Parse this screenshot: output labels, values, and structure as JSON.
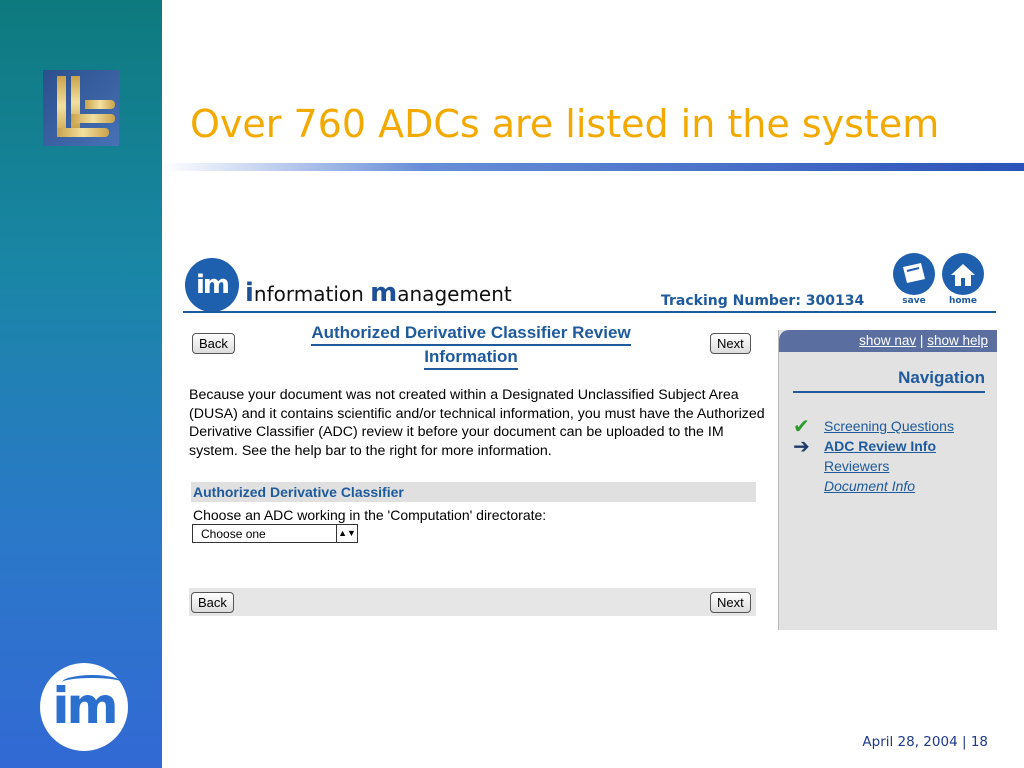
{
  "slide": {
    "title": "Over 760 ADCs are listed in the system",
    "footer_date": "April 28, 2004",
    "footer_separator": "|",
    "footer_page": "18"
  },
  "app": {
    "brand_initials": "im",
    "brand_name_part1": "i",
    "brand_name_part2": "nformation ",
    "brand_name_part3": "m",
    "brand_name_part4": "anagement",
    "tracking_label": "Tracking Number: 300134",
    "header_icons": [
      {
        "name": "save-icon",
        "label": "save"
      },
      {
        "name": "home-icon",
        "label": "home"
      }
    ],
    "back_label": "Back",
    "next_label": "Next",
    "form_title_line1": "Authorized Derivative Classifier Review",
    "form_title_line2": "Information",
    "intro": "Because your document was not created within a Designated Unclassified Subject Area (DUSA) and it contains scientific and/or technical information, you must have the Authorized Derivative Classifier (ADC) review it before your document can be uploaded to the IM system. See the help bar to the right for more information.",
    "section_heading": "Authorized Derivative Classifier",
    "choose_label": "Choose an ADC working in the 'Computation' directorate:",
    "select_value": "Choose one",
    "nav": {
      "show_nav": "show nav",
      "separator": "|",
      "show_help": "show help",
      "heading": "Navigation",
      "items": [
        {
          "label": "Screening Questions",
          "icon": "checkmark-icon"
        },
        {
          "label": "ADC Review Info",
          "icon": "arrow-right-icon"
        },
        {
          "label": "Reviewers",
          "icon": ""
        },
        {
          "label": "Document Info",
          "icon": ""
        }
      ]
    }
  },
  "colors": {
    "title": "#f2a900",
    "accent": "#1e5a9c"
  }
}
